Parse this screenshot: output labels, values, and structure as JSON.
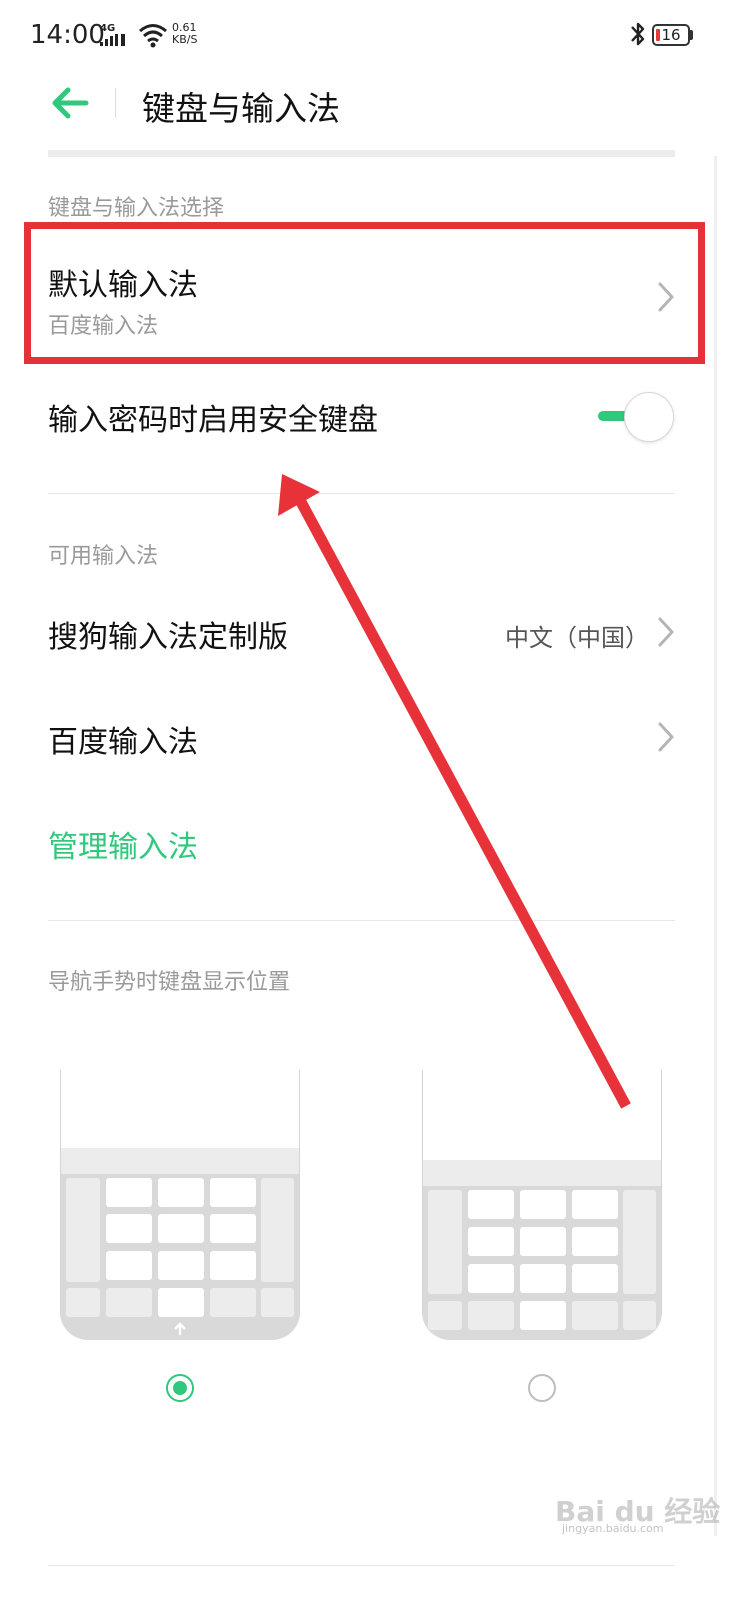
{
  "status_bar": {
    "time": "14:00",
    "network": "4G",
    "speed_value": "0.61",
    "speed_unit": "KB/S",
    "battery": "16"
  },
  "header": {
    "title": "键盘与输入法"
  },
  "section_selection": {
    "title": "键盘与输入法选择",
    "default_ime_label": "默认输入法",
    "default_ime_value": "百度输入法",
    "secure_keyboard_label": "输入密码时启用安全键盘",
    "secure_keyboard_on": true
  },
  "section_available": {
    "title": "可用输入法",
    "items": [
      {
        "label": "搜狗输入法定制版",
        "value": "中文（中国）"
      },
      {
        "label": "百度输入法",
        "value": ""
      }
    ],
    "manage_label": "管理输入法"
  },
  "section_position": {
    "title": "导航手势时键盘显示位置",
    "selected_option": 0
  },
  "watermark": {
    "text": "Bai du 经验",
    "sub": "jingyan.baidu.com"
  },
  "colors": {
    "accent": "#2fc87c",
    "highlight_box": "#e53238",
    "arrow": "#e8323a"
  },
  "icons": [
    "back-arrow-icon",
    "chevron-right-icon",
    "bluetooth-icon",
    "wifi-icon",
    "signal-icon",
    "battery-icon"
  ]
}
